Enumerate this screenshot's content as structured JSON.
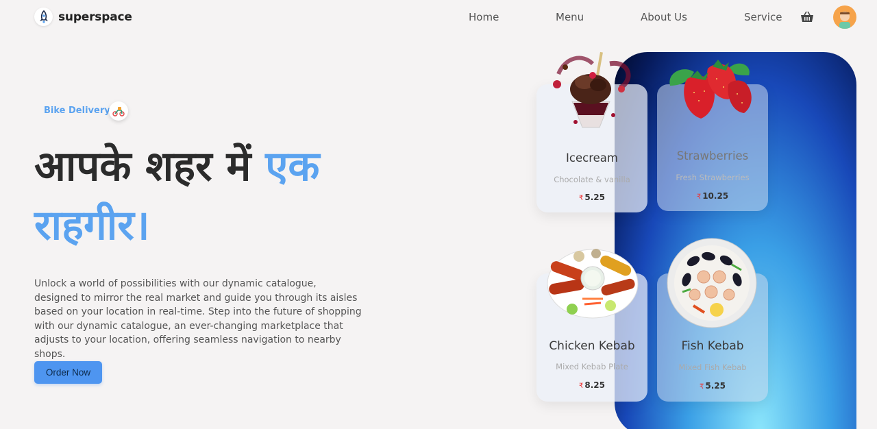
{
  "header": {
    "brand": "superspace",
    "nav": [
      "Home",
      "Menu",
      "About Us",
      "Service"
    ]
  },
  "hero": {
    "badge": "Bike Delivery",
    "headline_dark": "आपके शहर में ",
    "headline_accent_1": "एक",
    "headline_accent_2": "राहगीर।",
    "description": "Unlock a world of possibilities with our dynamic catalogue, designed to mirror the real market and guide you through its aisles based on your location in real-time. Step into the future of shopping with our dynamic catalogue, an ever-changing marketplace that adjusts to your location, offering seamless navigation to nearby shops.",
    "cta": "Order Now"
  },
  "products": [
    {
      "name": "Icecream",
      "subtitle": "Chocolate & vanilla",
      "currency": "₹",
      "price": "5.25"
    },
    {
      "name": "Strawberries",
      "subtitle": "Fresh Strawberries",
      "currency": "₹",
      "price": "10.25"
    },
    {
      "name": "Chicken Kebab",
      "subtitle": "Mixed Kebab Plate",
      "currency": "₹",
      "price": "8.25"
    },
    {
      "name": "Fish Kebab",
      "subtitle": "Mixed Fish Kebab",
      "currency": "₹",
      "price": "5.25"
    }
  ],
  "colors": {
    "accent": "#5ba3f0",
    "button": "#4e95f0",
    "background": "#f5f3f3",
    "price_currency": "#e33333"
  },
  "icons": [
    "rocket-logo-icon",
    "scooter-icon",
    "basket-icon",
    "user-avatar-icon"
  ]
}
